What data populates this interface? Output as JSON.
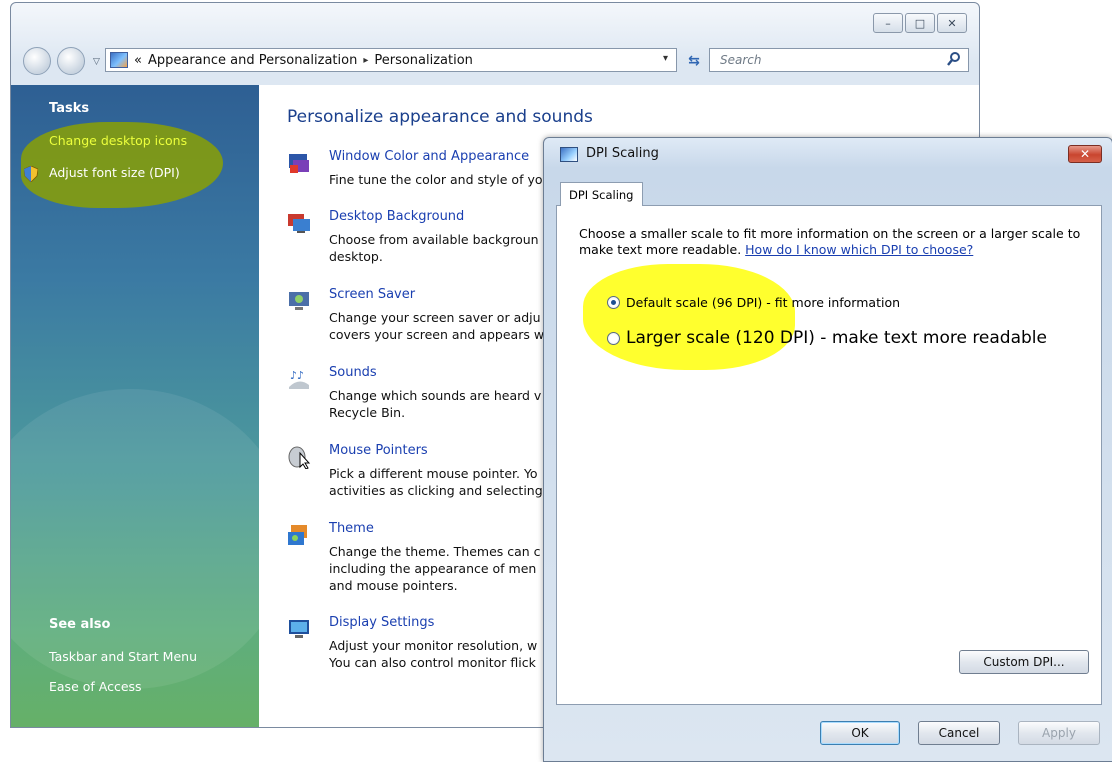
{
  "explorer": {
    "window_buttons": [
      "–",
      "□",
      "✕"
    ],
    "address": {
      "prefix": "«",
      "crumb1": "Appearance and Personalization",
      "separator": "▸",
      "crumb2": "Personalization",
      "dropdown": "▾"
    },
    "refresh_glyph": "⇆",
    "search": {
      "placeholder": "Search"
    },
    "tasks": {
      "heading": "Tasks",
      "items": [
        "Change desktop icons",
        "Adjust font size (DPI)"
      ]
    },
    "see_also": {
      "heading": "See also",
      "items": [
        "Taskbar and Start Menu",
        "Ease of Access"
      ]
    },
    "content": {
      "title": "Personalize appearance and sounds",
      "items": [
        {
          "label": "Window Color and Appearance",
          "desc": "Fine tune the color and style of yo"
        },
        {
          "label": "Desktop Background",
          "desc": "Choose from available backgroun\ndesktop."
        },
        {
          "label": "Screen Saver",
          "desc": "Change your screen saver or adju\ncovers your screen and appears w"
        },
        {
          "label": "Sounds",
          "desc": "Change which sounds are heard v\nRecycle Bin."
        },
        {
          "label": "Mouse Pointers",
          "desc": "Pick a different mouse pointer. Yo\nactivities as clicking and selecting"
        },
        {
          "label": "Theme",
          "desc": "Change the theme. Themes can c\nincluding the appearance of men\nand mouse pointers."
        },
        {
          "label": "Display Settings",
          "desc": "Adjust your monitor resolution, w\nYou can also control monitor flick"
        }
      ]
    }
  },
  "dialog": {
    "title": "DPI Scaling",
    "close_glyph": "✕",
    "tab_label": "DPI Scaling",
    "description": "Choose a smaller scale to fit more information on the screen or a larger scale to make text more readable.",
    "help_link": "How do I know which DPI to choose?",
    "options": [
      {
        "label": "Default scale (96 DPI) - fit more information",
        "checked": true
      },
      {
        "label": "Larger scale (120 DPI) - make text more readable",
        "checked": false
      }
    ],
    "custom_button": "Custom DPI...",
    "buttons": {
      "ok": "OK",
      "cancel": "Cancel",
      "apply": "Apply"
    }
  },
  "colors": {
    "link_blue": "#1a3fb0",
    "title_blue": "#1a3f8c",
    "highlight_yellow": "#ffff00",
    "highlight_green": "#8aa005",
    "task_link_yellow": "#ecff3c"
  }
}
